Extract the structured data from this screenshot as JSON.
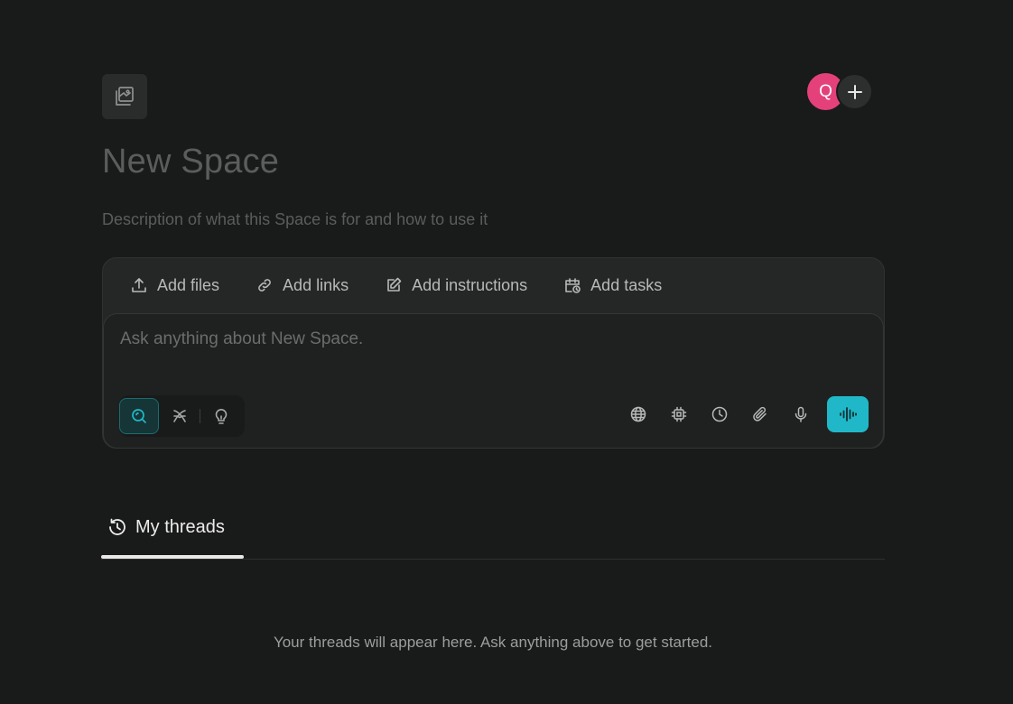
{
  "space": {
    "title": "New Space",
    "description": "Description of what this Space is for and how to use it"
  },
  "members": {
    "avatar_initial": "Q",
    "avatar_color": "#e4417a"
  },
  "composer": {
    "actions": {
      "add_files": "Add files",
      "add_links": "Add links",
      "add_instructions": "Add instructions",
      "add_tasks": "Add tasks"
    },
    "placeholder": "Ask anything about New Space.",
    "modes": [
      "search",
      "research",
      "labs"
    ],
    "active_mode": "search",
    "tools": [
      "globe-icon",
      "cpu-icon",
      "clock-icon",
      "paperclip-icon",
      "microphone-icon"
    ],
    "accent_color": "#20b8c8"
  },
  "threads": {
    "tab_label": "My threads",
    "empty_message": "Your threads will appear here. Ask anything above to get started."
  }
}
